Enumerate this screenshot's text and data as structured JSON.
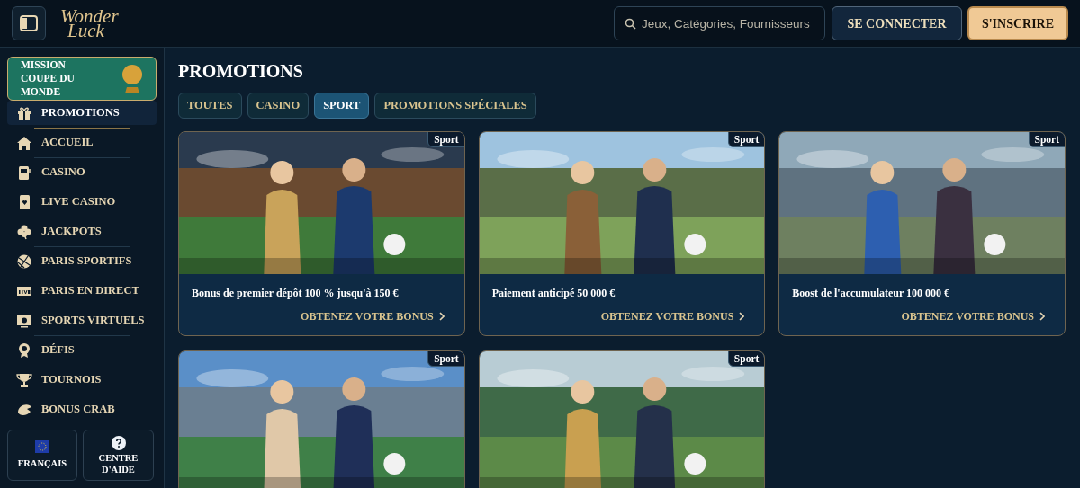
{
  "header": {
    "logo_line1": "Wonder",
    "logo_line2": "Luck",
    "search": {
      "placeholder": "Jeux, Catégories, Fournisseurs"
    },
    "login_button": "SE CONNECTER",
    "signup_button": "S'INSCRIRE"
  },
  "sidebar": {
    "banner": "MISSION COUPE DU MONDE",
    "items": [
      {
        "label": "PROMOTIONS",
        "selected": true,
        "divider_after": true
      },
      {
        "label": "ACCUEIL",
        "selected": false,
        "divider_after": true
      },
      {
        "label": "CASINO",
        "selected": false,
        "divider_after": false
      },
      {
        "label": "LIVE CASINO",
        "selected": false,
        "divider_after": false
      },
      {
        "label": "JACKPOTS",
        "selected": false,
        "divider_after": true
      },
      {
        "label": "PARIS SPORTIFS",
        "selected": false,
        "divider_after": false
      },
      {
        "label": "PARIS EN DIRECT",
        "selected": false,
        "divider_after": false
      },
      {
        "label": "SPORTS VIRTUELS",
        "selected": false,
        "divider_after": true
      },
      {
        "label": "DÉFIS",
        "selected": false,
        "divider_after": false
      },
      {
        "label": "TOURNOIS",
        "selected": false,
        "divider_after": false
      },
      {
        "label": "BONUS CRAB",
        "selected": false,
        "divider_after": false
      }
    ],
    "language_button": "FRANÇAIS",
    "help_button": "CENTRE D'AIDE"
  },
  "main": {
    "title": "PROMOTIONS",
    "tabs": [
      {
        "label": "TOUTES",
        "selected": false
      },
      {
        "label": "CASINO",
        "selected": false
      },
      {
        "label": "SPORT",
        "selected": true
      },
      {
        "label": "PROMOTIONS SPÉCIALES",
        "selected": false
      }
    ],
    "cards": [
      {
        "badge": "Sport",
        "title": "Bonus de premier dépôt 100 % jusqu'à 150 €",
        "cta": "OBTENEZ VOTRE BONUS"
      },
      {
        "badge": "Sport",
        "title": "Paiement anticipé 50 000 €",
        "cta": "OBTENEZ VOTRE BONUS"
      },
      {
        "badge": "Sport",
        "title": "Boost de l'accumulateur 100 000 €",
        "cta": "OBTENEZ VOTRE BONUS"
      },
      {
        "badge": "Sport"
      },
      {
        "badge": "Sport"
      }
    ]
  }
}
